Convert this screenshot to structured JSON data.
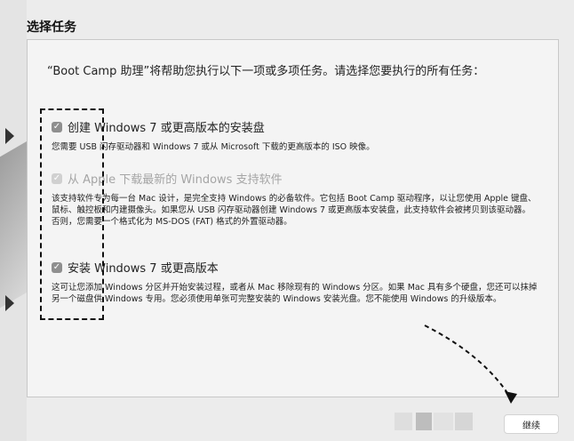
{
  "window": {
    "title": "选择任务"
  },
  "intro": "“Boot Camp 助理”将帮助您执行以下一项或多项任务。请选择您要执行的所有任务：",
  "options": [
    {
      "label": "创建 Windows 7 或更高版本的安装盘",
      "checked": true,
      "enabled": true,
      "description": "您需要 USB 闪存驱动器和 Windows 7 或从 Microsoft 下载的更高版本的 ISO 映像。"
    },
    {
      "label": "从 Apple 下载最新的 Windows 支持软件",
      "checked": true,
      "enabled": false,
      "description": "该支持软件专为每一台 Mac 设计，是完全支持 Windows 的必备软件。它包括 Boot Camp 驱动程序，以让您使用 Apple 键盘、鼠标、触控板和内建摄像头。如果您从 USB 闪存驱动器创建 Windows 7 或更高版本安装盘，此支持软件会被拷贝到该驱动器。否则，您需要一个格式化为 MS-DOS (FAT) 格式的外置驱动器。"
    },
    {
      "label": "安装 Windows 7 或更高版本",
      "checked": true,
      "enabled": true,
      "description": "这可让您添加 Windows 分区并开始安装过程，或者从 Mac 移除现有的 Windows 分区。如果 Mac 具有多个硬盘，您还可以抹掉另一个磁盘供 Windows 专用。您必须使用单张可完整安装的 Windows 安装光盘。您不能使用 Windows 的升级版本。"
    }
  ],
  "footer": {
    "continue_label": "继续"
  },
  "icons": {
    "checkbox": "checkmark-icon"
  }
}
